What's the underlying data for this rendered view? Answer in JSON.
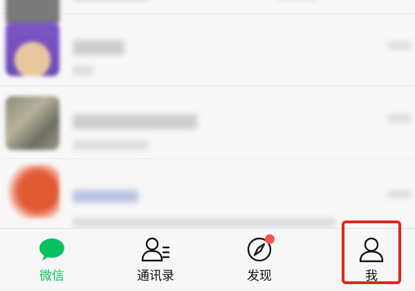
{
  "tabbar": {
    "tabs": [
      {
        "label": "微信",
        "icon": "chat-bubble-icon",
        "active": true
      },
      {
        "label": "通讯录",
        "icon": "contacts-icon",
        "active": false
      },
      {
        "label": "发现",
        "icon": "compass-icon",
        "active": false,
        "badge": "dot"
      },
      {
        "label": "我",
        "icon": "person-icon",
        "active": false
      }
    ]
  },
  "colors": {
    "active": "#07c160",
    "badge": "#fa5151",
    "highlight": "#e8201a"
  }
}
